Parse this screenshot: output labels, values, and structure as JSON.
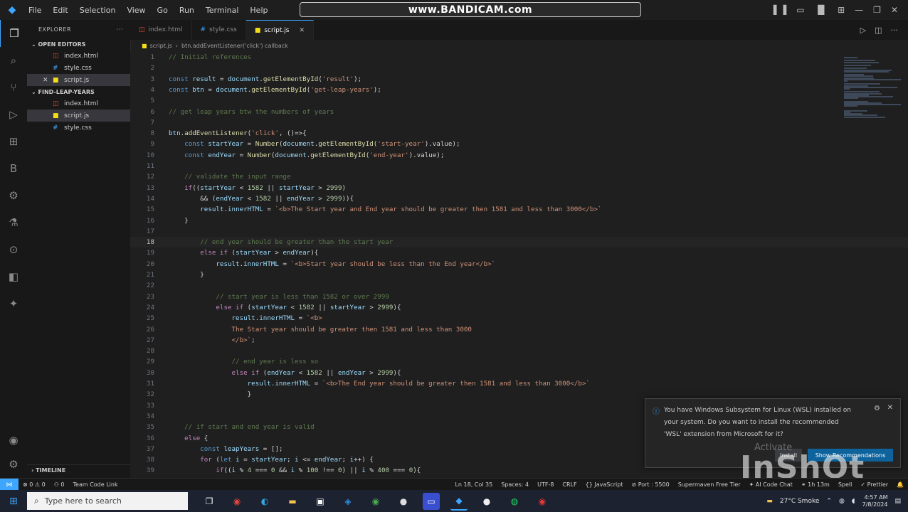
{
  "titlebar": {
    "menu": [
      "File",
      "Edit",
      "Selection",
      "View",
      "Go",
      "Run",
      "Terminal",
      "Help"
    ],
    "command_center": "www.BANDICAM.com"
  },
  "sidebar": {
    "title": "EXPLORER",
    "open_editors_label": "OPEN EDITORS",
    "open_editors": [
      {
        "name": "index.html",
        "color": "#e44d26"
      },
      {
        "name": "style.css",
        "color": "#42a5f5"
      },
      {
        "name": "script.js",
        "color": "#f5de19",
        "selected": true
      }
    ],
    "folder_label": "FIND-LEAP-YEARS",
    "folder_items": [
      {
        "name": "index.html",
        "color": "#e44d26"
      },
      {
        "name": "script.js",
        "color": "#f5de19",
        "selected": true
      },
      {
        "name": "style.css",
        "color": "#42a5f5"
      }
    ],
    "timeline_label": "TIMELINE"
  },
  "tabs": [
    {
      "name": "index.html",
      "color": "#e44d26"
    },
    {
      "name": "style.css",
      "color": "#42a5f5"
    },
    {
      "name": "script.js",
      "color": "#f5de19",
      "active": true
    }
  ],
  "breadcrumb": [
    "script.js",
    "btn.addEventListener('click') callback"
  ],
  "editor": {
    "current_line": 18,
    "lines": [
      [
        [
          "// Initial references",
          "cm"
        ]
      ],
      [],
      [
        [
          "const ",
          "kw"
        ],
        [
          "result",
          "var"
        ],
        [
          " = ",
          ""
        ],
        [
          "document",
          "var"
        ],
        [
          ".",
          ""
        ],
        [
          "getElementById",
          "fn"
        ],
        [
          "(",
          ""
        ],
        [
          "'result'",
          "str"
        ],
        [
          ");",
          ""
        ]
      ],
      [
        [
          "const ",
          "kw"
        ],
        [
          "btn",
          "var"
        ],
        [
          " = ",
          ""
        ],
        [
          "document",
          "var"
        ],
        [
          ".",
          ""
        ],
        [
          "getElementById",
          "fn"
        ],
        [
          "(",
          ""
        ],
        [
          "'get-leap-years'",
          "str"
        ],
        [
          ");",
          ""
        ]
      ],
      [],
      [
        [
          "// get leap years btw the numbers of years",
          "cm"
        ]
      ],
      [],
      [
        [
          "btn",
          "var"
        ],
        [
          ".",
          ""
        ],
        [
          "addEventListener",
          "fn"
        ],
        [
          "(",
          ""
        ],
        [
          "'click'",
          "str"
        ],
        [
          ", ()=>{",
          ""
        ]
      ],
      [
        [
          "    const ",
          "kw"
        ],
        [
          "startYear",
          "var"
        ],
        [
          " = ",
          ""
        ],
        [
          "Number",
          "fn"
        ],
        [
          "(",
          ""
        ],
        [
          "document",
          "var"
        ],
        [
          ".",
          ""
        ],
        [
          "getElementById",
          "fn"
        ],
        [
          "(",
          ""
        ],
        [
          "'start-year'",
          "str"
        ],
        [
          ").value);",
          ""
        ]
      ],
      [
        [
          "    const ",
          "kw"
        ],
        [
          "endYear",
          "var"
        ],
        [
          " = ",
          ""
        ],
        [
          "Number",
          "fn"
        ],
        [
          "(",
          ""
        ],
        [
          "document",
          "var"
        ],
        [
          ".",
          ""
        ],
        [
          "getElementById",
          "fn"
        ],
        [
          "(",
          ""
        ],
        [
          "'end-year'",
          "str"
        ],
        [
          ").value);",
          ""
        ]
      ],
      [],
      [
        [
          "    // validate the input range",
          "cm"
        ]
      ],
      [
        [
          "    if",
          "ctl"
        ],
        [
          "((",
          ""
        ],
        [
          "startYear",
          "var"
        ],
        [
          " < ",
          ""
        ],
        [
          "1582",
          "num"
        ],
        [
          " || ",
          ""
        ],
        [
          "startYear",
          "var"
        ],
        [
          " > ",
          ""
        ],
        [
          "2999",
          "num"
        ],
        [
          ")",
          ""
        ]
      ],
      [
        [
          "        && (",
          ""
        ],
        [
          "endYear",
          "var"
        ],
        [
          " < ",
          ""
        ],
        [
          "1582",
          "num"
        ],
        [
          " || ",
          ""
        ],
        [
          "endYear",
          "var"
        ],
        [
          " > ",
          ""
        ],
        [
          "2999",
          "num"
        ],
        [
          ")){",
          ""
        ]
      ],
      [
        [
          "        ",
          ""
        ],
        [
          "result",
          "var"
        ],
        [
          ".",
          ""
        ],
        [
          "innerHTML",
          "var"
        ],
        [
          " = ",
          ""
        ],
        [
          "`<b>The Start year and End year should be greater then 1581 and less than 3000</b>`",
          "str"
        ]
      ],
      [
        [
          "    }",
          ""
        ]
      ],
      [],
      [
        [
          "        // end year should be greater than the start year",
          "cm"
        ]
      ],
      [
        [
          "        else if",
          "ctl"
        ],
        [
          " (",
          ""
        ],
        [
          "startYear",
          "var"
        ],
        [
          " > ",
          ""
        ],
        [
          "endYear",
          "var"
        ],
        [
          "){",
          ""
        ]
      ],
      [
        [
          "            ",
          ""
        ],
        [
          "result",
          "var"
        ],
        [
          ".",
          ""
        ],
        [
          "innerHTML",
          "var"
        ],
        [
          " = ",
          ""
        ],
        [
          "`<b>Start year should be less than the End year</b>`",
          "str"
        ]
      ],
      [
        [
          "        }",
          ""
        ]
      ],
      [],
      [
        [
          "            // start year is less than 1582 or over 2999",
          "cm"
        ]
      ],
      [
        [
          "            else if",
          "ctl"
        ],
        [
          " (",
          ""
        ],
        [
          "startYear",
          "var"
        ],
        [
          " < ",
          ""
        ],
        [
          "1582",
          "num"
        ],
        [
          " || ",
          ""
        ],
        [
          "startYear",
          "var"
        ],
        [
          " > ",
          ""
        ],
        [
          "2999",
          "num"
        ],
        [
          "){",
          ""
        ]
      ],
      [
        [
          "                ",
          ""
        ],
        [
          "result",
          "var"
        ],
        [
          ".",
          ""
        ],
        [
          "innerHTML",
          "var"
        ],
        [
          " = ",
          ""
        ],
        [
          "`<b>",
          "str"
        ]
      ],
      [
        [
          "                The Start year should be greater then 1581 and less than 3000",
          "str"
        ]
      ],
      [
        [
          "                </b>`",
          "str"
        ],
        [
          ";",
          ""
        ]
      ],
      [],
      [
        [
          "                // end year is less so",
          "cm"
        ]
      ],
      [
        [
          "                else if",
          "ctl"
        ],
        [
          " (",
          ""
        ],
        [
          "endYear",
          "var"
        ],
        [
          " < ",
          ""
        ],
        [
          "1582",
          "num"
        ],
        [
          " || ",
          ""
        ],
        [
          "endYear",
          "var"
        ],
        [
          " > ",
          ""
        ],
        [
          "2999",
          "num"
        ],
        [
          "){",
          ""
        ]
      ],
      [
        [
          "                    ",
          ""
        ],
        [
          "result",
          "var"
        ],
        [
          ".",
          ""
        ],
        [
          "innerHTML",
          "var"
        ],
        [
          " = ",
          ""
        ],
        [
          "`<b>The End year should be greater then 1581 and less than 3000</b>`",
          "str"
        ]
      ],
      [
        [
          "                    }",
          ""
        ]
      ],
      [],
      [],
      [
        [
          "    // if start and end year is valid",
          "cm"
        ]
      ],
      [
        [
          "    else",
          "ctl"
        ],
        [
          " {",
          ""
        ]
      ],
      [
        [
          "        const ",
          "kw"
        ],
        [
          "leapYears",
          "var"
        ],
        [
          " = [];",
          ""
        ]
      ],
      [
        [
          "        for",
          "ctl"
        ],
        [
          " (",
          ""
        ],
        [
          "let ",
          "kw"
        ],
        [
          "i",
          "var"
        ],
        [
          " = ",
          ""
        ],
        [
          "startYear",
          "var"
        ],
        [
          "; ",
          ""
        ],
        [
          "i",
          "var"
        ],
        [
          " <= ",
          ""
        ],
        [
          "endYear",
          "var"
        ],
        [
          "; ",
          ""
        ],
        [
          "i",
          "var"
        ],
        [
          "++) {",
          ""
        ]
      ],
      [
        [
          "            if",
          "ctl"
        ],
        [
          "((",
          ""
        ],
        [
          "i",
          "var"
        ],
        [
          " % ",
          ""
        ],
        [
          "4",
          "num"
        ],
        [
          " === ",
          ""
        ],
        [
          "0",
          "num"
        ],
        [
          " && ",
          ""
        ],
        [
          "i",
          "var"
        ],
        [
          " % ",
          ""
        ],
        [
          "100",
          "num"
        ],
        [
          " !== ",
          ""
        ],
        [
          "0",
          "num"
        ],
        [
          ") || ",
          ""
        ],
        [
          "i",
          "var"
        ],
        [
          " % ",
          ""
        ],
        [
          "400",
          "num"
        ],
        [
          " === ",
          ""
        ],
        [
          "0",
          "num"
        ],
        [
          "){",
          ""
        ]
      ]
    ]
  },
  "status": {
    "left": [
      "⊗ 0 ⚠ 0",
      "⚇ 0",
      "Team Code Link"
    ],
    "right": [
      "Ln 18, Col 35",
      "Spaces: 4",
      "UTF-8",
      "CRLF",
      "{} JavaScript",
      "⊘ Port : 5500",
      "Supermaven Free Tier",
      "✦ AI Code Chat",
      "⚭ 1h 13m",
      "Spell",
      "✓ Prettier",
      "🔔"
    ]
  },
  "taskbar": {
    "search_placeholder": "Type here to search",
    "weather": "27°C Smoke",
    "time": "4:57 AM",
    "date": "7/8/2024"
  },
  "notification": {
    "message": "You have Windows Subsystem for Linux (WSL) installed on your system. Do you want to install the recommended 'WSL' extension from Microsoft for it?",
    "primary_button": "Install",
    "secondary_button": "Show Recommendations"
  },
  "watermark": {
    "activate_text": "Activate",
    "inshot_text": "InShOt"
  }
}
